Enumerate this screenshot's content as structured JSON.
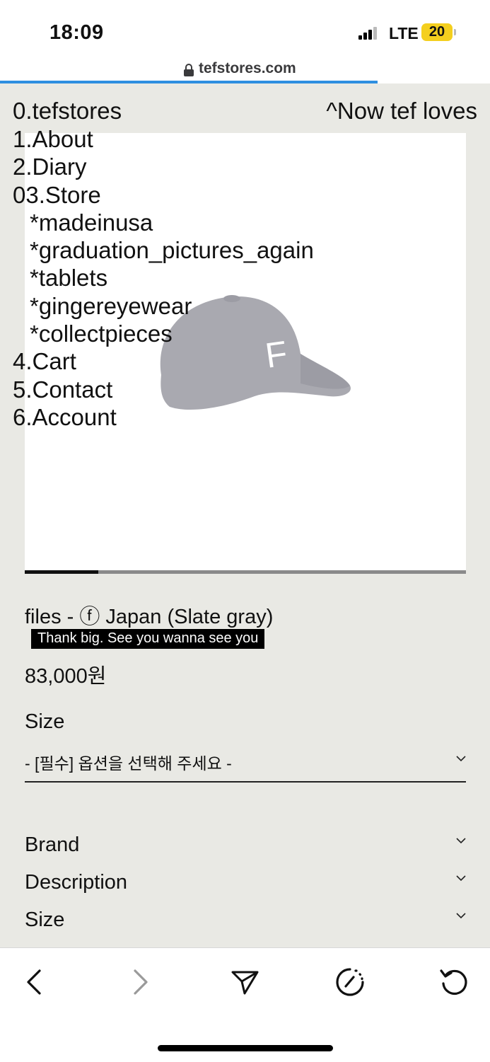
{
  "status": {
    "time": "18:09",
    "carrier": "LTE",
    "battery": "20",
    "battery_color": "#f4cf1e"
  },
  "browser": {
    "url": "tefstores.com",
    "load_progress": 0.77,
    "accent": "#2f8fe0"
  },
  "site": {
    "logo": "0.tefstores",
    "tagline": "^Now tef loves",
    "menu": [
      {
        "label": "1.About"
      },
      {
        "label": "2.Diary"
      },
      {
        "label": "03.Store"
      },
      {
        "label": "*madeinusa"
      },
      {
        "label": "*graduation_pictures_again"
      },
      {
        "label": "*tablets"
      },
      {
        "label": "*gingereyewear"
      },
      {
        "label": "*collectpieces"
      },
      {
        "label": "4.Cart"
      },
      {
        "label": "5.Contact"
      },
      {
        "label": "6.Account"
      }
    ]
  },
  "product": {
    "image_icon": "baseball-cap-image",
    "cap_color": "#a9a9b0",
    "gallery_position": 0.167,
    "title": "files - ⓕ Japan (Slate gray)",
    "note": "Thank big. See you wanna see you",
    "price": "83,000원",
    "size_label": "Size",
    "size_select_value": "- [필수] 옵션을 선택해 주세요 -"
  },
  "accordion": [
    {
      "label": "Brand"
    },
    {
      "label": "Description"
    },
    {
      "label": "Size"
    }
  ],
  "toolbar": {
    "icons": [
      "back-icon",
      "forward-icon",
      "share-icon",
      "speed-icon",
      "reload-icon"
    ]
  }
}
